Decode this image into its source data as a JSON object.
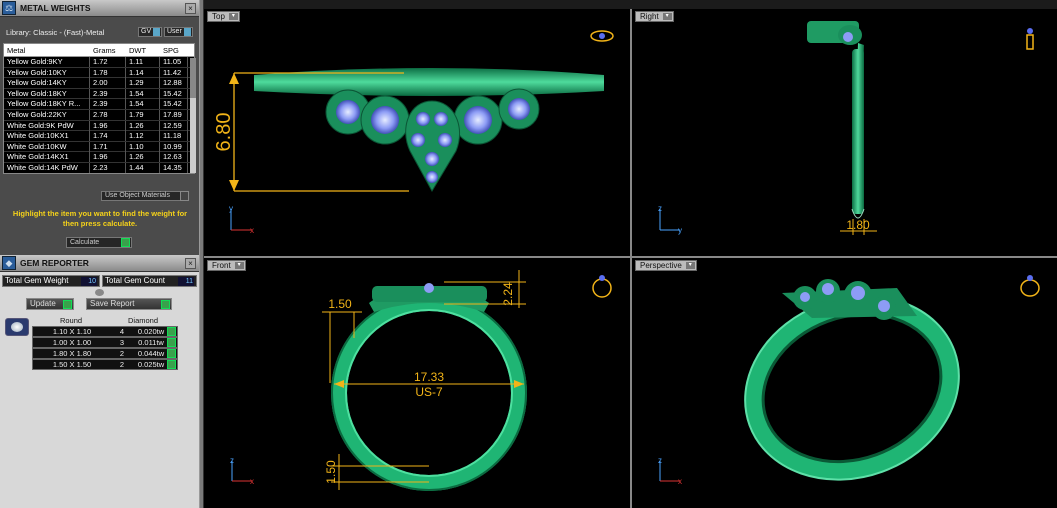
{
  "metal_weights": {
    "title": "METAL WEIGHTS",
    "library_label": "Library: Classic - (Fast)-Metal",
    "gv_label": "GV",
    "user_label": "User",
    "columns": [
      "Metal",
      "Grams",
      "DWT",
      "SPG"
    ],
    "rows": [
      [
        "Yellow Gold:9KY",
        "1.72",
        "1.11",
        "11.05"
      ],
      [
        "Yellow Gold:10KY",
        "1.78",
        "1.14",
        "11.42"
      ],
      [
        "Yellow Gold:14KY",
        "2.00",
        "1.29",
        "12.88"
      ],
      [
        "Yellow Gold:18KY",
        "2.39",
        "1.54",
        "15.42"
      ],
      [
        "Yellow Gold:18KY R...",
        "2.39",
        "1.54",
        "15.42"
      ],
      [
        "Yellow Gold:22KY",
        "2.78",
        "1.79",
        "17.89"
      ],
      [
        "White Gold:9K PdW",
        "1.96",
        "1.26",
        "12.59"
      ],
      [
        "White Gold:10KX1",
        "1.74",
        "1.12",
        "11.18"
      ],
      [
        "White Gold:10KW",
        "1.71",
        "1.10",
        "10.99"
      ],
      [
        "White Gold:14KX1",
        "1.96",
        "1.26",
        "12.63"
      ],
      [
        "White Gold:14K PdW",
        "2.23",
        "1.44",
        "14.35"
      ]
    ],
    "use_object_materials": "Use Object Materials",
    "instruction": "Highlight the item you want to find the weight for then press calculate.",
    "calculate_label": "Calculate"
  },
  "gem_reporter": {
    "title": "GEM REPORTER",
    "total_gem_weight_label": "Total Gem Weight",
    "total_gem_weight": "10",
    "total_gem_count_label": "Total Gem Count",
    "total_gem_count": "11",
    "update_label": "Update",
    "save_report_label": "Save Report",
    "shape_header": "Round",
    "type_header": "Diamond",
    "rows": [
      [
        "1.10 X 1.10",
        "4",
        "0.020tw"
      ],
      [
        "1.00 X 1.00",
        "3",
        "0.011tw"
      ],
      [
        "1.80 X 1.80",
        "2",
        "0.044tw"
      ],
      [
        "1.50 X 1.50",
        "2",
        "0.025tw"
      ]
    ]
  },
  "viewports": {
    "top": {
      "label": "Top",
      "dim_height": "6.80"
    },
    "right": {
      "label": "Right",
      "dim_width": "1.80"
    },
    "front": {
      "label": "Front",
      "dim_inner": "17.33",
      "ring_size": "US-7",
      "dim_left": "1.50",
      "dim_top": "2.24",
      "dim_bottom": "1.50"
    },
    "perspective": {
      "label": "Perspective"
    }
  },
  "colors": {
    "metal": "#1fb574",
    "metal_light": "#5ee0a8",
    "metal_dark": "#0a6b40",
    "gem": "#8fa0ff",
    "dimension": "#f2b418"
  }
}
